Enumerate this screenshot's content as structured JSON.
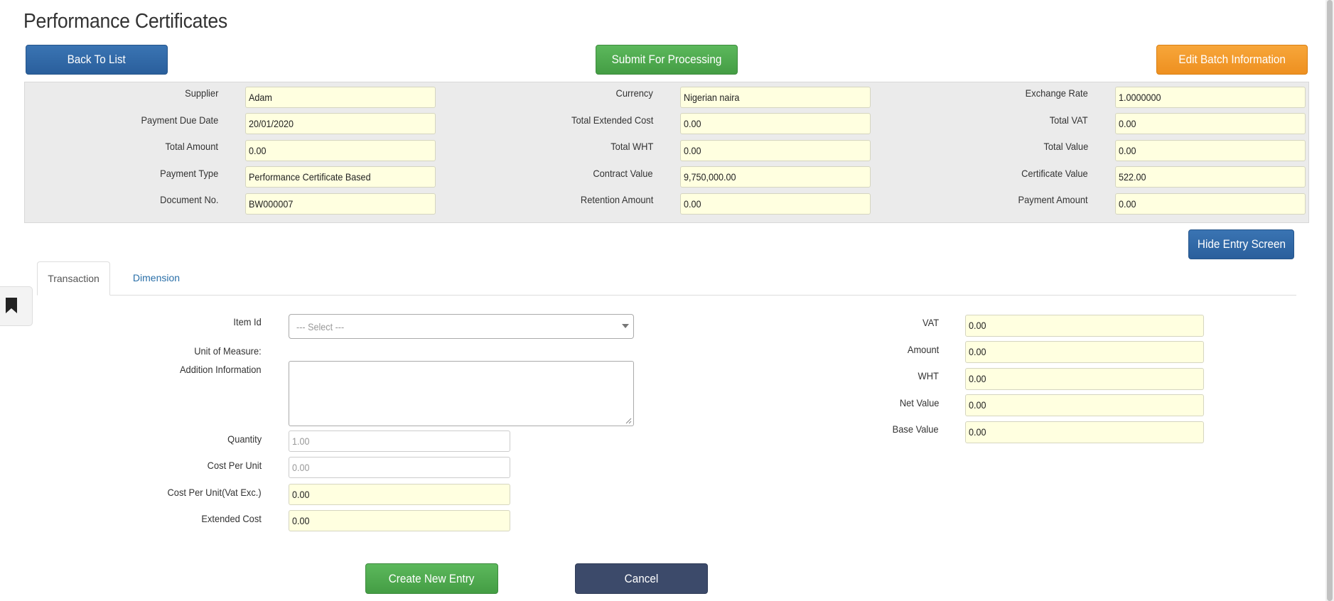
{
  "page": {
    "title": "Performance Certificates"
  },
  "toolbar": {
    "back_label": "Back To List",
    "submit_label": "Submit For Processing",
    "edit_batch_label": "Edit Batch Information"
  },
  "batch": {
    "supplier": {
      "label": "Supplier",
      "value": "Adam"
    },
    "payment_due_date": {
      "label": "Payment Due Date",
      "value": "20/01/2020"
    },
    "total_amount": {
      "label": "Total Amount",
      "value": "0.00"
    },
    "payment_type": {
      "label": "Payment Type",
      "value": "Performance Certificate Based"
    },
    "document_no": {
      "label": "Document No.",
      "value": "BW000007"
    },
    "currency": {
      "label": "Currency",
      "value": "Nigerian naira"
    },
    "total_extended_cost": {
      "label": "Total Extended Cost",
      "value": "0.00"
    },
    "total_wht": {
      "label": "Total WHT",
      "value": "0.00"
    },
    "contract_value": {
      "label": "Contract Value",
      "value": "9,750,000.00"
    },
    "retention_amount": {
      "label": "Retention Amount",
      "value": "0.00"
    },
    "exchange_rate": {
      "label": "Exchange Rate",
      "value": "1.0000000"
    },
    "total_vat": {
      "label": "Total VAT",
      "value": "0.00"
    },
    "total_value": {
      "label": "Total Value",
      "value": "0.00"
    },
    "certificate_value": {
      "label": "Certificate Value",
      "value": "522.00"
    },
    "payment_amount": {
      "label": "Payment Amount",
      "value": "0.00"
    }
  },
  "hide_entry_label": "Hide Entry Screen",
  "tabs": [
    {
      "label": "Transaction",
      "active": true
    },
    {
      "label": "Dimension",
      "active": false
    }
  ],
  "entry": {
    "item_id": {
      "label": "Item Id",
      "placeholder": "--- Select ---"
    },
    "unit_of_measure": {
      "label": "Unit of Measure:"
    },
    "addition_information": {
      "label": "Addition Information",
      "value": ""
    },
    "quantity": {
      "label": "Quantity",
      "value": "1.00"
    },
    "cost_per_unit": {
      "label": "Cost Per Unit",
      "value": "0.00"
    },
    "cost_per_unit_vat_exc": {
      "label": "Cost Per Unit(Vat Exc.)",
      "value": "0.00"
    },
    "extended_cost": {
      "label": "Extended Cost",
      "value": "0.00"
    },
    "vat": {
      "label": "VAT",
      "value": "0.00"
    },
    "amount": {
      "label": "Amount",
      "value": "0.00"
    },
    "wht": {
      "label": "WHT",
      "value": "0.00"
    },
    "net_value": {
      "label": "Net Value",
      "value": "0.00"
    },
    "base_value": {
      "label": "Base Value",
      "value": "0.00"
    }
  },
  "actions": {
    "create_label": "Create New Entry",
    "cancel_label": "Cancel"
  },
  "colors": {
    "primary": "#2a5f9c",
    "success": "#449d44",
    "warning": "#ee9020",
    "dark": "#3c4a6a",
    "readonly_field": "#ffffe0"
  },
  "icons": {
    "side_tab": "bookmark-icon",
    "select_caret": "chevron-down-icon"
  }
}
